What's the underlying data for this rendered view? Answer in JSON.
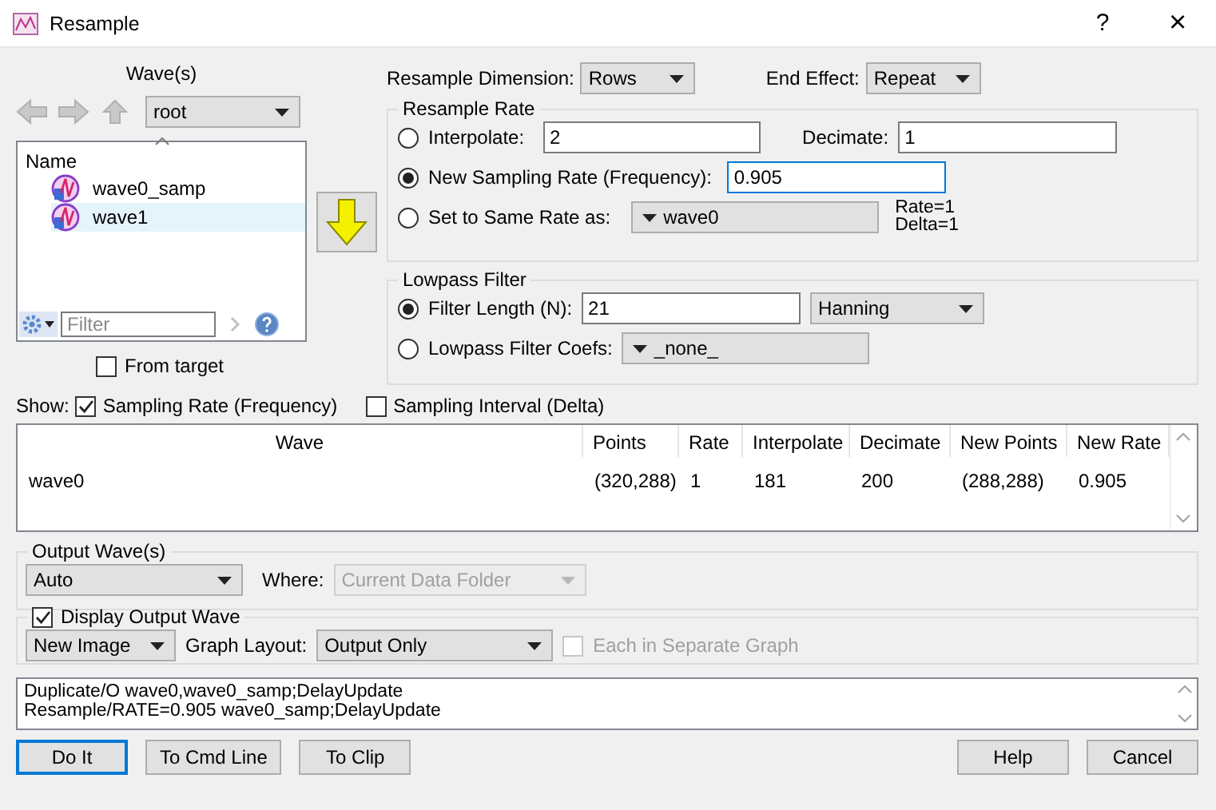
{
  "window": {
    "title": "Resample",
    "help": "?",
    "close": "×"
  },
  "wave_browser": {
    "title": "Wave(s)",
    "folder": "root",
    "column": "Name",
    "filter_placeholder": "Filter",
    "items": [
      {
        "name": "wave0_samp",
        "selected": false
      },
      {
        "name": "wave1",
        "selected": true
      }
    ],
    "from_target": {
      "label": "From target",
      "checked": false
    }
  },
  "dimension": {
    "label": "Resample Dimension:",
    "value": "Rows"
  },
  "end_effect": {
    "label": "End Effect:",
    "value": "Repeat"
  },
  "resample_rate": {
    "title": "Resample Rate",
    "interpolate": {
      "label": "Interpolate:",
      "value": "2",
      "selected": false
    },
    "decimate": {
      "label": "Decimate:",
      "value": "1"
    },
    "new_rate": {
      "label": "New Sampling Rate (Frequency):",
      "value": "0.905",
      "selected": true,
      "focused": true
    },
    "same_rate": {
      "label": "Set to Same Rate as:",
      "value": "wave0",
      "selected": false,
      "info": [
        "Rate=1",
        "Delta=1"
      ]
    }
  },
  "lowpass_filter": {
    "title": "Lowpass Filter",
    "filter_length": {
      "label": "Filter Length (N):",
      "value": "21",
      "window": "Hanning",
      "selected": true
    },
    "coefs": {
      "label": "Lowpass Filter Coefs:",
      "value": "_none_",
      "selected": false
    }
  },
  "show": {
    "label": "Show:",
    "options": [
      {
        "label": "Sampling Rate (Frequency)",
        "checked": true
      },
      {
        "label": "Sampling Interval (Delta)",
        "checked": false
      }
    ]
  },
  "table": {
    "columns": [
      "Wave",
      "Points",
      "Rate",
      "Interpolate",
      "Decimate",
      "New Points",
      "New Rate"
    ],
    "rows": [
      [
        "wave0",
        "(320,288)",
        "1",
        "181",
        "200",
        "(288,288)",
        "0.905"
      ]
    ]
  },
  "output": {
    "title": "Output Wave(s)",
    "name": "Auto",
    "where_label": "Where:",
    "where": "Current Data Folder",
    "where_disabled": true
  },
  "display": {
    "label": "Display Output Wave",
    "checked": true,
    "mode": "New Image",
    "layout_label": "Graph Layout:",
    "layout": "Output Only",
    "separate": {
      "label": "Each in Separate Graph",
      "checked": false,
      "disabled": true
    }
  },
  "command": [
    "Duplicate/O wave0,wave0_samp;DelayUpdate",
    "Resample/RATE=0.905 wave0_samp;DelayUpdate"
  ],
  "buttons": [
    {
      "label": "Do It",
      "default": true
    },
    {
      "label": "To Cmd Line",
      "default": false
    },
    {
      "label": "To Clip",
      "default": false
    }
  ],
  "right_buttons": [
    {
      "label": "Help",
      "default": false
    },
    {
      "label": "Cancel",
      "default": false
    }
  ]
}
